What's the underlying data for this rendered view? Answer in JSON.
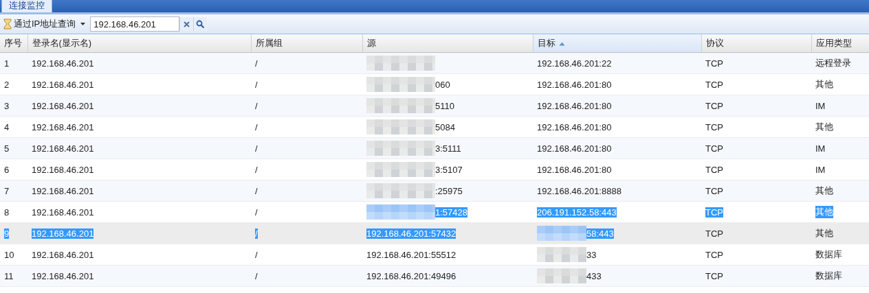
{
  "tab": {
    "label": "连接监控",
    "selected": true
  },
  "toolbar": {
    "query_menu": "通过IP地址查询",
    "search_value": "192.168.46.201"
  },
  "table": {
    "columns": [
      {
        "label": "序号",
        "sorted": false
      },
      {
        "label": "登录名(显示名)",
        "sorted": false
      },
      {
        "label": "所属组",
        "sorted": false
      },
      {
        "label": "源",
        "sorted": false
      },
      {
        "label": "目标",
        "sorted": true
      },
      {
        "label": "协议",
        "sorted": false
      },
      {
        "label": "应用类型",
        "sorted": false
      }
    ],
    "rows": [
      {
        "selected": false,
        "cells": [
          {
            "text": "1",
            "masked": false,
            "highlighted": false
          },
          {
            "text": "192.168.46.201",
            "masked": false,
            "highlighted": false
          },
          {
            "text": "/",
            "masked": false,
            "highlighted": false
          },
          {
            "masked": true,
            "highlighted": false
          },
          {
            "text": "192.168.46.201:22",
            "masked": false,
            "highlighted": false
          },
          {
            "text": "TCP",
            "masked": false,
            "highlighted": false
          },
          {
            "text": "远程登录",
            "masked": false,
            "highlighted": false
          }
        ]
      },
      {
        "selected": false,
        "cells": [
          {
            "text": "2",
            "masked": false,
            "highlighted": false
          },
          {
            "text": "192.168.46.201",
            "masked": false,
            "highlighted": false
          },
          {
            "text": "/",
            "masked": false,
            "highlighted": false
          },
          {
            "text": "060",
            "masked": true,
            "highlighted": false
          },
          {
            "text": "192.168.46.201:80",
            "masked": false,
            "highlighted": false
          },
          {
            "text": "TCP",
            "masked": false,
            "highlighted": false
          },
          {
            "text": "其他",
            "masked": false,
            "highlighted": false
          }
        ]
      },
      {
        "selected": false,
        "cells": [
          {
            "text": "3",
            "masked": false,
            "highlighted": false
          },
          {
            "text": "192.168.46.201",
            "masked": false,
            "highlighted": false
          },
          {
            "text": "/",
            "masked": false,
            "highlighted": false
          },
          {
            "text": "5110",
            "masked": true,
            "highlighted": false
          },
          {
            "text": "192.168.46.201:80",
            "masked": false,
            "highlighted": false
          },
          {
            "text": "TCP",
            "masked": false,
            "highlighted": false
          },
          {
            "text": "IM",
            "masked": false,
            "highlighted": false
          }
        ]
      },
      {
        "selected": false,
        "cells": [
          {
            "text": "4",
            "masked": false,
            "highlighted": false
          },
          {
            "text": "192.168.46.201",
            "masked": false,
            "highlighted": false
          },
          {
            "text": "/",
            "masked": false,
            "highlighted": false
          },
          {
            "text": "5084",
            "masked": true,
            "highlighted": false
          },
          {
            "text": "192.168.46.201:80",
            "masked": false,
            "highlighted": false
          },
          {
            "text": "TCP",
            "masked": false,
            "highlighted": false
          },
          {
            "text": "其他",
            "masked": false,
            "highlighted": false
          }
        ]
      },
      {
        "selected": false,
        "cells": [
          {
            "text": "5",
            "masked": false,
            "highlighted": false
          },
          {
            "text": "192.168.46.201",
            "masked": false,
            "highlighted": false
          },
          {
            "text": "/",
            "masked": false,
            "highlighted": false
          },
          {
            "text": "3:5111",
            "masked": true,
            "highlighted": false
          },
          {
            "text": "192.168.46.201:80",
            "masked": false,
            "highlighted": false
          },
          {
            "text": "TCP",
            "masked": false,
            "highlighted": false
          },
          {
            "text": "IM",
            "masked": false,
            "highlighted": false
          }
        ]
      },
      {
        "selected": false,
        "cells": [
          {
            "text": "6",
            "masked": false,
            "highlighted": false
          },
          {
            "text": "192.168.46.201",
            "masked": false,
            "highlighted": false
          },
          {
            "text": "/",
            "masked": false,
            "highlighted": false
          },
          {
            "text": "3:5107",
            "masked": true,
            "highlighted": false
          },
          {
            "text": "192.168.46.201:80",
            "masked": false,
            "highlighted": false
          },
          {
            "text": "TCP",
            "masked": false,
            "highlighted": false
          },
          {
            "text": "IM",
            "masked": false,
            "highlighted": false
          }
        ]
      },
      {
        "selected": false,
        "cells": [
          {
            "text": "7",
            "masked": false,
            "highlighted": false
          },
          {
            "text": "192.168.46.201",
            "masked": false,
            "highlighted": false
          },
          {
            "text": "/",
            "masked": false,
            "highlighted": false
          },
          {
            "text": ":25975",
            "masked": true,
            "highlighted": false
          },
          {
            "text": "192.168.46.201:8888",
            "masked": false,
            "highlighted": false
          },
          {
            "text": "TCP",
            "masked": false,
            "highlighted": false
          },
          {
            "text": "其他",
            "masked": false,
            "highlighted": false
          }
        ]
      },
      {
        "selected": false,
        "cells": [
          {
            "text": "8",
            "masked": false,
            "highlighted": false
          },
          {
            "text": "192.168.46.201",
            "masked": false,
            "highlighted": false
          },
          {
            "text": "/",
            "masked": false,
            "highlighted": false
          },
          {
            "text": "1:57428",
            "masked": true,
            "highlighted": true
          },
          {
            "text": "206.191.152.58:443",
            "masked": false,
            "highlighted": true
          },
          {
            "text": "TCP",
            "masked": false,
            "highlighted": true
          },
          {
            "text": "其他",
            "masked": false,
            "highlighted": true
          }
        ]
      },
      {
        "selected": true,
        "cells": [
          {
            "text": "9",
            "masked": false,
            "highlighted": true
          },
          {
            "text": "192.168.46.201",
            "masked": false,
            "highlighted": true
          },
          {
            "text": "/",
            "masked": false,
            "highlighted": true
          },
          {
            "text": "192.168.46.201:57432",
            "masked": false,
            "highlighted": true
          },
          {
            "text": "58:443",
            "masked": true,
            "highlighted": true
          },
          {
            "text": "TCP",
            "masked": false,
            "highlighted": false
          },
          {
            "text": "其他",
            "masked": false,
            "highlighted": false
          }
        ]
      },
      {
        "selected": false,
        "cells": [
          {
            "text": "10",
            "masked": false,
            "highlighted": false
          },
          {
            "text": "192.168.46.201",
            "masked": false,
            "highlighted": false
          },
          {
            "text": "/",
            "masked": false,
            "highlighted": false
          },
          {
            "text": "192.168.46.201:55512",
            "masked": false,
            "highlighted": false
          },
          {
            "text": "33",
            "masked": true,
            "highlighted": false
          },
          {
            "text": "TCP",
            "masked": false,
            "highlighted": false
          },
          {
            "text": "数据库",
            "masked": false,
            "highlighted": false
          }
        ]
      },
      {
        "selected": false,
        "cells": [
          {
            "text": "11",
            "masked": false,
            "highlighted": false
          },
          {
            "text": "192.168.46.201",
            "masked": false,
            "highlighted": false
          },
          {
            "text": "/",
            "masked": false,
            "highlighted": false
          },
          {
            "text": "192.168.46.201:49496",
            "masked": false,
            "highlighted": false
          },
          {
            "text": "433",
            "masked": true,
            "highlighted": false
          },
          {
            "text": "TCP",
            "masked": false,
            "highlighted": false
          },
          {
            "text": "数据库",
            "masked": false,
            "highlighted": false
          }
        ]
      }
    ]
  }
}
